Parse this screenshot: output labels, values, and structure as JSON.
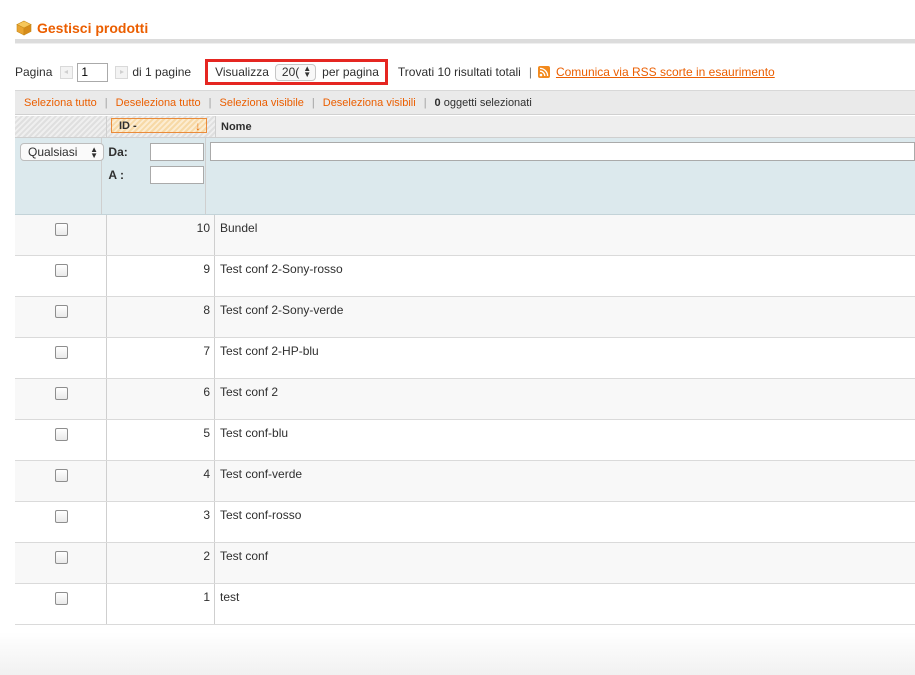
{
  "header": {
    "title": "Gestisci prodotti"
  },
  "pager": {
    "page_label": "Pagina",
    "page_value": "1",
    "of_pages": "di 1 pagine",
    "view_label": "Visualizza",
    "per_page_value": "20(",
    "per_page_label": "per pagina",
    "found_text": "Trovati 10 risultati totali",
    "rss_text": "Comunica via RSS scorte in esaurimento"
  },
  "massaction": {
    "select_all": "Seleziona tutto",
    "deselect_all": "Deseleziona tutto",
    "select_visible": "Seleziona visibile",
    "deselect_visible": "Deseleziona visibili",
    "selected_count": "0",
    "selected_label": "oggetti selezionati"
  },
  "grid": {
    "columns": {
      "id": "ID -",
      "name": "Nome"
    },
    "filters": {
      "qualsiasi": "Qualsiasi",
      "from_label": "Da:",
      "to_label": "A :"
    },
    "rows": [
      {
        "id": "10",
        "name": "Bundel"
      },
      {
        "id": "9",
        "name": "Test conf 2-Sony-rosso"
      },
      {
        "id": "8",
        "name": "Test conf 2-Sony-verde"
      },
      {
        "id": "7",
        "name": "Test conf 2-HP-blu"
      },
      {
        "id": "6",
        "name": "Test conf 2"
      },
      {
        "id": "5",
        "name": "Test conf-blu"
      },
      {
        "id": "4",
        "name": "Test conf-verde"
      },
      {
        "id": "3",
        "name": "Test conf-rosso"
      },
      {
        "id": "2",
        "name": "Test conf"
      },
      {
        "id": "1",
        "name": "test"
      }
    ]
  },
  "colors": {
    "accent": "#eb5e00",
    "highlight_border": "#e52621",
    "filter_bg": "#dce9ed"
  }
}
